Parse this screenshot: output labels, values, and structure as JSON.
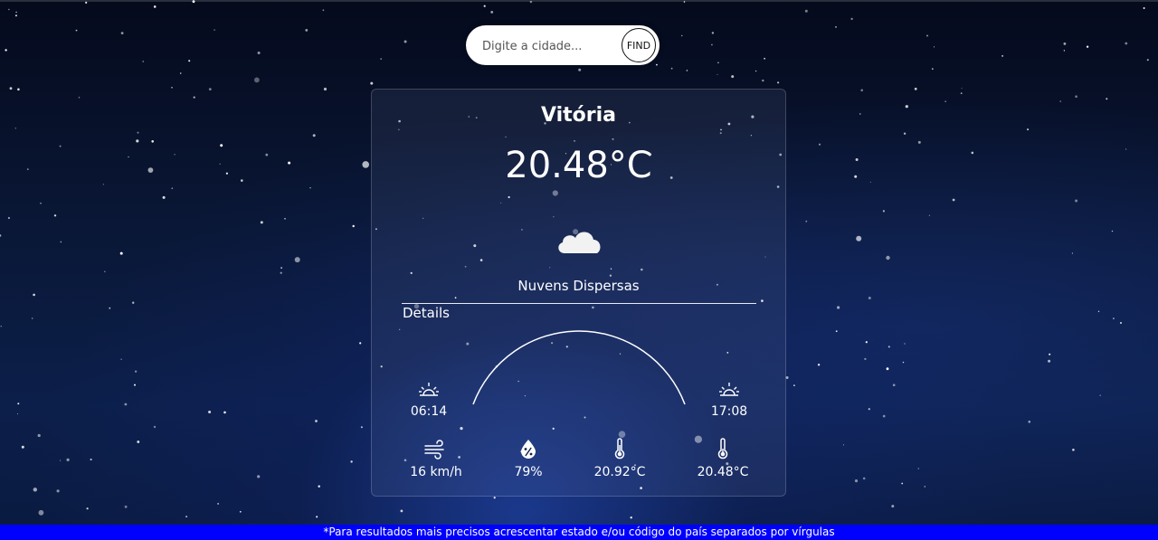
{
  "search": {
    "placeholder": "Digite a cidade...",
    "button_label": "FIND"
  },
  "weather": {
    "city": "Vitória",
    "temperature": "20.48°C",
    "icon": "cloud-icon",
    "description": "Nuvens Dispersas"
  },
  "details": {
    "title": "Details",
    "sunrise": "06:14",
    "sunset": "17:08",
    "wind": "16 km/h",
    "humidity": "79%",
    "temp_max": "20.92°C",
    "temp_min": "20.48°C"
  },
  "footer": {
    "note": "*Para resultados mais precisos acrescentar estado e/ou código do país separados por vírgulas"
  },
  "colors": {
    "footer_bg": "#0000ff",
    "background": "#0a1838"
  }
}
